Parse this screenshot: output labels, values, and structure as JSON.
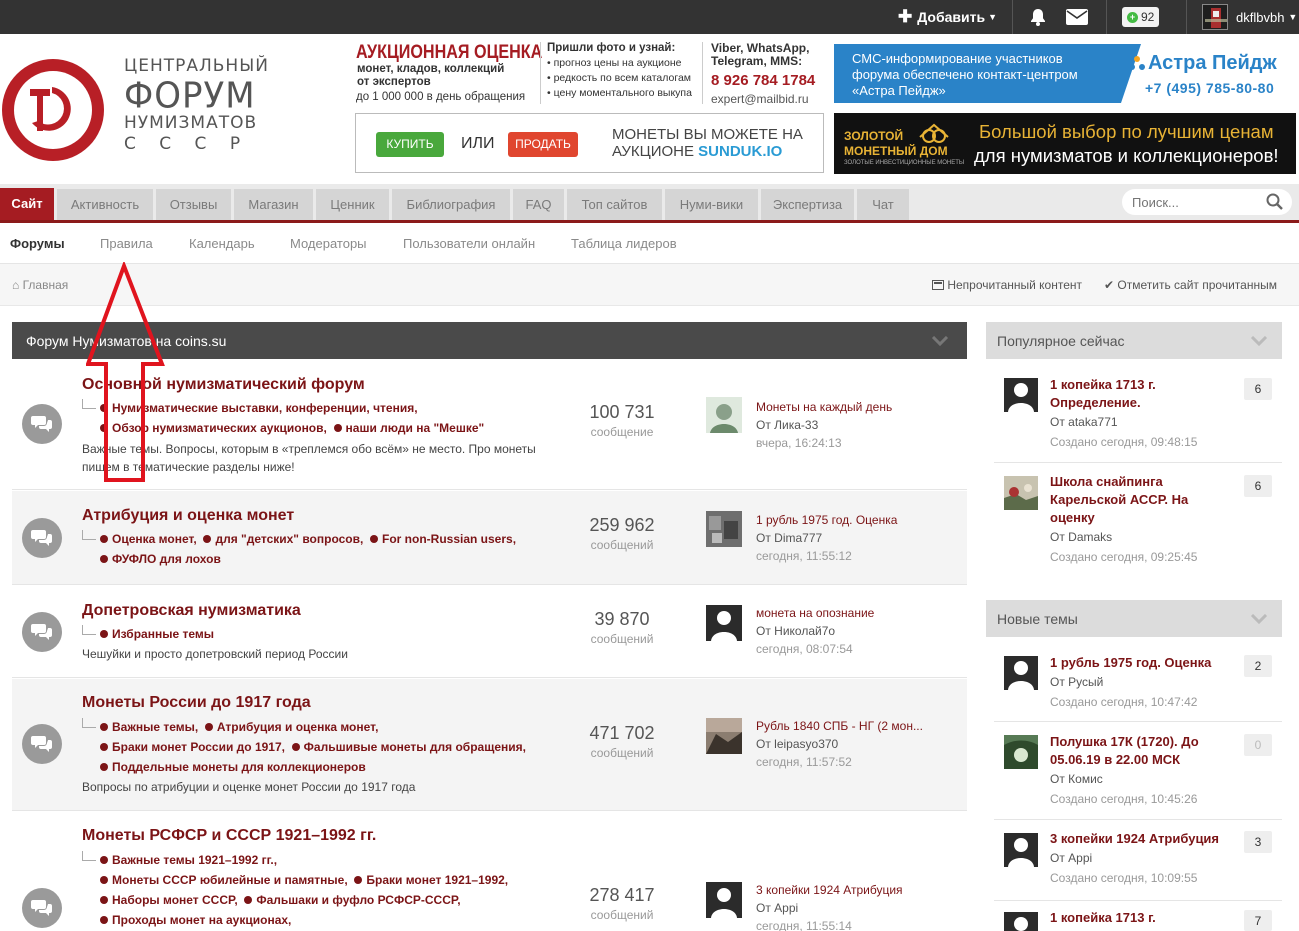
{
  "userbar": {
    "add_label": "Добавить",
    "reputation": "92",
    "username": "dkflbvbh"
  },
  "logo": {
    "line1": "ЦЕНТРАЛЬНЫЙ",
    "line2": "ФОРУМ",
    "line3": "НУМИЗМАТОВ",
    "line4": "С С С Р"
  },
  "ads": {
    "auction": {
      "title": "АУКЦИОННАЯ ОЦЕНКА",
      "subtitle1": "монет, кладов, коллекций",
      "subtitle2": "от экспертов",
      "limit": "до 1 000 000 в день обращения",
      "mid_head": "Пришли фото и узнай:",
      "mid_items": [
        "прогноз цены на аукционе",
        "редкость по всем каталогам",
        "цену моментального выкупа"
      ],
      "contacts_head1": "Viber, WhatsApp,",
      "contacts_head2": "Telegram, MMS:",
      "phone": "8 926 784 1784",
      "email": "expert@mailbid.ru"
    },
    "sunduk": {
      "buy": "КУПИТЬ",
      "or": "ИЛИ",
      "sell": "ПРОДАТЬ",
      "line1": "МОНЕТЫ ВЫ МОЖЕТЕ НА",
      "line2_prefix": "АУКЦИОНЕ ",
      "line2_brand": "SUNDUK.IO"
    },
    "astra": {
      "line1": "СМС-информирование участников",
      "line2": "форума обеспечено контакт-центром",
      "line3": "«Астра Пейдж»",
      "brand": "Астра Пейдж",
      "phone": "+7 (495) 785-80-80"
    },
    "gold": {
      "line1": "ЗОЛОТОЙ",
      "line2": "МОНЕТНЫЙ ДОМ",
      "tag": "ЗОЛОТЫЕ ИНВЕСТИЦИОННЫЕ МОНЕТЫ",
      "slogan1": "Большой выбор по лучшим ценам",
      "slogan2": "для нумизматов и коллекционеров!"
    }
  },
  "nav": {
    "tabs": [
      "Сайт",
      "Активность",
      "Отзывы",
      "Магазин",
      "Ценник",
      "Библиография",
      "FAQ",
      "Топ сайтов",
      "Нуми-вики",
      "Экспертиза",
      "Чат"
    ],
    "search_placeholder": "Поиск..."
  },
  "subnav": [
    "Форумы",
    "Правила",
    "Календарь",
    "Модераторы",
    "Пользователи онлайн",
    "Таблица лидеров"
  ],
  "breadcrumb": {
    "home": "Главная",
    "unread": "Непрочитанный контент",
    "mark_read": "Отметить сайт прочитанным"
  },
  "forum_block": {
    "title": "Форум Нумизматов на coins.su",
    "count_label": "сообщение",
    "count_label_plural": "сообщений",
    "forums": [
      {
        "title": "Основной нумизматический форум",
        "subforums": [
          [
            "Нумизматические выставки, конференции, чтения,"
          ],
          [
            "Обзор нумизматических аукционов,",
            "наши люди на \"Мешке\""
          ]
        ],
        "desc1": "Важные темы. Вопросы, которым в «треплемся обо всём» не место. Про монеты",
        "desc2": "пишем в тематические разделы ниже!",
        "count": "100 731",
        "last_title": "Монеты на каждый день",
        "last_by": "От Лика-33",
        "last_date": "вчера, 16:24:13"
      },
      {
        "title": "Атрибуция и оценка монет",
        "subforums": [
          [
            "Оценка монет,",
            "для \"детских\" вопросов,",
            "For non-Russian users,"
          ],
          [
            "ФУФЛО для лохов"
          ]
        ],
        "count": "259 962",
        "last_title": "1 рубль 1975 год. Оценка",
        "last_by": "От Dima777",
        "last_date": "сегодня, 11:55:12"
      },
      {
        "title": "Допетровская нумизматика",
        "subforums": [
          [
            "Избранные темы"
          ]
        ],
        "desc1": "Чешуйки и просто допетровский период России",
        "count": "39 870",
        "last_title": "монета на опознание",
        "last_by": "От Николай7о",
        "last_date": "сегодня, 08:07:54"
      },
      {
        "title": "Монеты России до 1917 года",
        "subforums": [
          [
            "Важные темы,",
            "Атрибуция и оценка монет,"
          ],
          [
            "Браки монет России до 1917,",
            "Фальшивые монеты для обращения,"
          ],
          [
            "Поддельные монеты для коллекционеров"
          ]
        ],
        "desc1": "Вопросы по атрибуции и оценке монет России до 1917 года",
        "count": "471 702",
        "last_title": "Рубль 1840 СПБ - НГ (2 мон...",
        "last_by": "От leipasyo370",
        "last_date": "сегодня, 11:57:52"
      },
      {
        "title": "Монеты РСФСР и СССР 1921–1992 гг.",
        "subforums": [
          [
            "Важные темы 1921–1992 гг.,"
          ],
          [
            "Монеты СССР юбилейные и памятные,",
            "Браки монет 1921–1992,"
          ],
          [
            "Наборы монет СССР,",
            "Фальшаки и фуфло РСФСР-СССР,"
          ],
          [
            "Проходы монет на аукционах,"
          ]
        ],
        "count": "278 417",
        "last_title": "3 копейки 1924 Атрибуция",
        "last_by": "От Appi",
        "last_date": "сегодня, 11:55:14"
      }
    ]
  },
  "sidebar": {
    "popular_title": "Популярное сейчас",
    "popular": [
      {
        "title1": "1 копейка 1713 г.",
        "title2": "Определение.",
        "title3": "",
        "by": "От ataka771",
        "date": "Создано сегодня, 09:48:15",
        "count": "6"
      },
      {
        "title1": "Школа снайпинга",
        "title2": "Карельской АССР. На",
        "title3": "оценку",
        "by": "От Damaks",
        "date": "Создано сегодня, 09:25:45",
        "count": "6"
      }
    ],
    "new_title": "Новые темы",
    "new": [
      {
        "title1": "1 рубль 1975 год. Оценка",
        "title2": "",
        "by": "От Русый",
        "date": "Создано сегодня, 10:47:42",
        "count": "2"
      },
      {
        "title1": "Полушка 17К (1720). До",
        "title2": "05.06.19 в 22.00 МСК",
        "by": "От Комис",
        "date": "Создано сегодня, 10:45:26",
        "count": "0"
      },
      {
        "title1": "3 копейки 1924 Атрибуция",
        "title2": "",
        "by": "От Appi",
        "date": "Создано сегодня, 10:09:55",
        "count": "3"
      },
      {
        "title1": "1 копейка 1713 г.",
        "title2": "",
        "by": "",
        "date": "",
        "count": "7"
      }
    ]
  },
  "colors": {
    "brand_red": "#a51c22",
    "link_dark_red": "#7b1416",
    "astra_blue": "#2a83c8",
    "gold": "#e8b335"
  }
}
